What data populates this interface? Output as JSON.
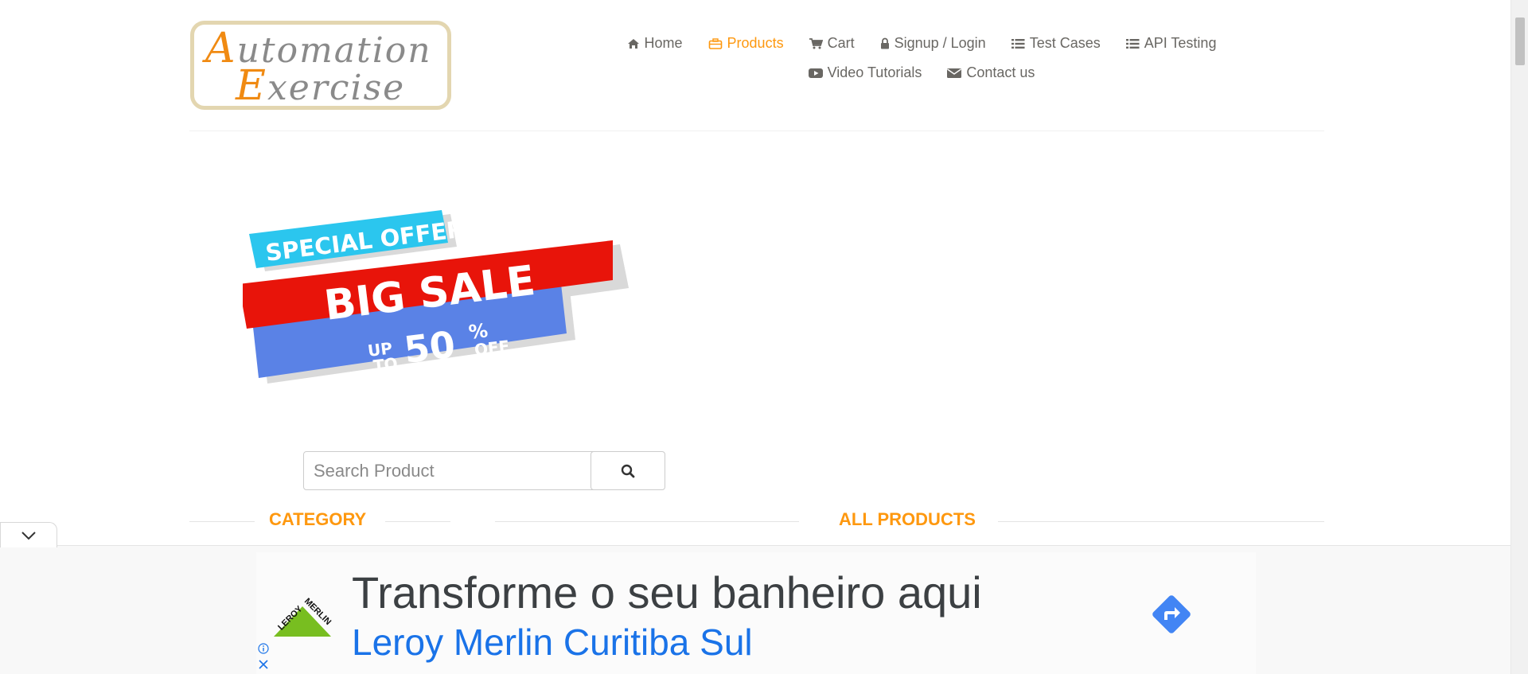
{
  "logo": {
    "line1_cap": "A",
    "line1_rest": "utomation",
    "line2_cap": "E",
    "line2_rest": "xercise"
  },
  "nav": {
    "home": "Home",
    "products": "Products",
    "cart": "Cart",
    "login": "Signup / Login",
    "test_cases": "Test Cases",
    "api_testing": "API Testing",
    "video_tutorials": "Video Tutorials",
    "contact": "Contact us"
  },
  "banner": {
    "special_offer": "SPECIAL OFFER",
    "big_sale": "BIG SALE",
    "up": "UP",
    "to": "TO",
    "percent_value": "50",
    "percent_sign": "%",
    "off": "OFF"
  },
  "search": {
    "placeholder": "Search Product"
  },
  "sections": {
    "category": "Category",
    "all_products": "All Products"
  },
  "ad": {
    "headline": "Transforme o seu banheiro aqui",
    "subline": "Leroy Merlin Curitiba Sul",
    "brand_logo": "LEROY MERLIN"
  },
  "colors": {
    "accent": "#fe980f",
    "ad_link": "#1a73e8",
    "banner_blue_light": "#2bc6ee",
    "banner_red": "#e8140a",
    "banner_blue": "#5a82e6"
  }
}
